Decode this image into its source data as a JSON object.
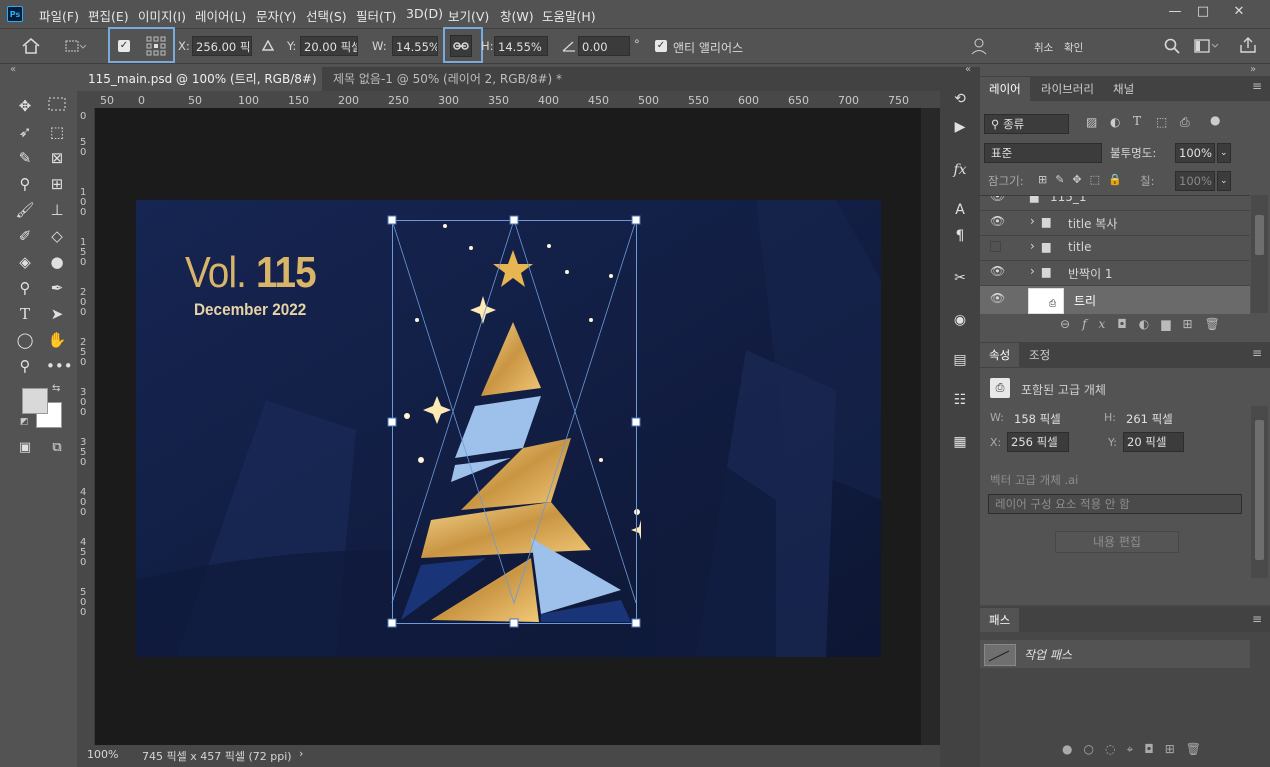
{
  "app": {
    "logo": "Ps"
  },
  "menu": [
    "파일(F)",
    "편집(E)",
    "이미지(I)",
    "레이어(L)",
    "문자(Y)",
    "선택(S)",
    "필터(T)",
    "3D(D)",
    "보기(V)",
    "창(W)",
    "도움말(H)"
  ],
  "window_controls": {
    "minimize": "—",
    "maximize": "□",
    "close": "✕"
  },
  "options": {
    "x_label": "X:",
    "x_value": "256.00 픽셀",
    "y_label": "Y:",
    "y_value": "20.00 픽셀",
    "w_label": "W:",
    "w_value": "14.55%",
    "h_label": "H:",
    "h_value": "14.55%",
    "angle_value": "0.00",
    "angle_unit": "°",
    "antialias_label": "앤티 앨리어스",
    "cancel_label": "취소",
    "confirm_label": "확인"
  },
  "tabs": [
    {
      "label": "115_main.psd @ 100% (트리, RGB/8#) *",
      "active": true
    },
    {
      "label": "제목 없음-1 @ 50% (레이어 2, RGB/8#) *",
      "active": false
    }
  ],
  "ruler_h": [
    "50",
    "0",
    "50",
    "100",
    "150",
    "200",
    "250",
    "300",
    "350",
    "400",
    "450",
    "500",
    "550",
    "600",
    "650",
    "700",
    "750"
  ],
  "ruler_v": [
    "0",
    "5 0",
    "1 0 0",
    "1 5 0",
    "2 0 0",
    "2 5 0",
    "3 0 0",
    "3 5 0",
    "4 0 0",
    "4 5 0",
    "5 0 0"
  ],
  "artwork": {
    "title_prefix": "Vol.",
    "title_number": "115",
    "subtitle": "December 2022"
  },
  "status": {
    "zoom": "100%",
    "doc_info": "745 픽셀 x 457 픽셀 (72 ppi)",
    "arrow": "›"
  },
  "layers_panel": {
    "tabs": [
      "레이어",
      "라이브러리",
      "채널"
    ],
    "filter_label": "종류",
    "blend_mode": "표준",
    "opacity_label": "불투명도:",
    "opacity_value": "100%",
    "lock_label": "잠그기:",
    "fill_label": "칠:",
    "fill_value": "100%",
    "layers": [
      {
        "name": "115_1",
        "visible": true,
        "type": "group"
      },
      {
        "name": "title 복사",
        "visible": true,
        "type": "group"
      },
      {
        "name": "title",
        "visible": false,
        "type": "group"
      },
      {
        "name": "반짝이 1",
        "visible": true,
        "type": "group"
      },
      {
        "name": "트리",
        "visible": true,
        "type": "smart",
        "selected": true
      }
    ]
  },
  "properties_panel": {
    "tabs": [
      "속성",
      "조정"
    ],
    "kind": "포함된 고급 개체",
    "w_label": "W:",
    "w_value": "158 픽셀",
    "h_label": "H:",
    "h_value": "261 픽셀",
    "x_label": "X:",
    "x_value": "256 픽셀",
    "y_label": "Y:",
    "y_value": "20 픽셀",
    "vector_label": "벡터 고급 개체 .ai",
    "comp_value": "레이어 구성 요소 적용 안 함",
    "edit_button": "내용 편집"
  },
  "paths_panel": {
    "tab": "패스",
    "work_path": "작업 패스"
  }
}
